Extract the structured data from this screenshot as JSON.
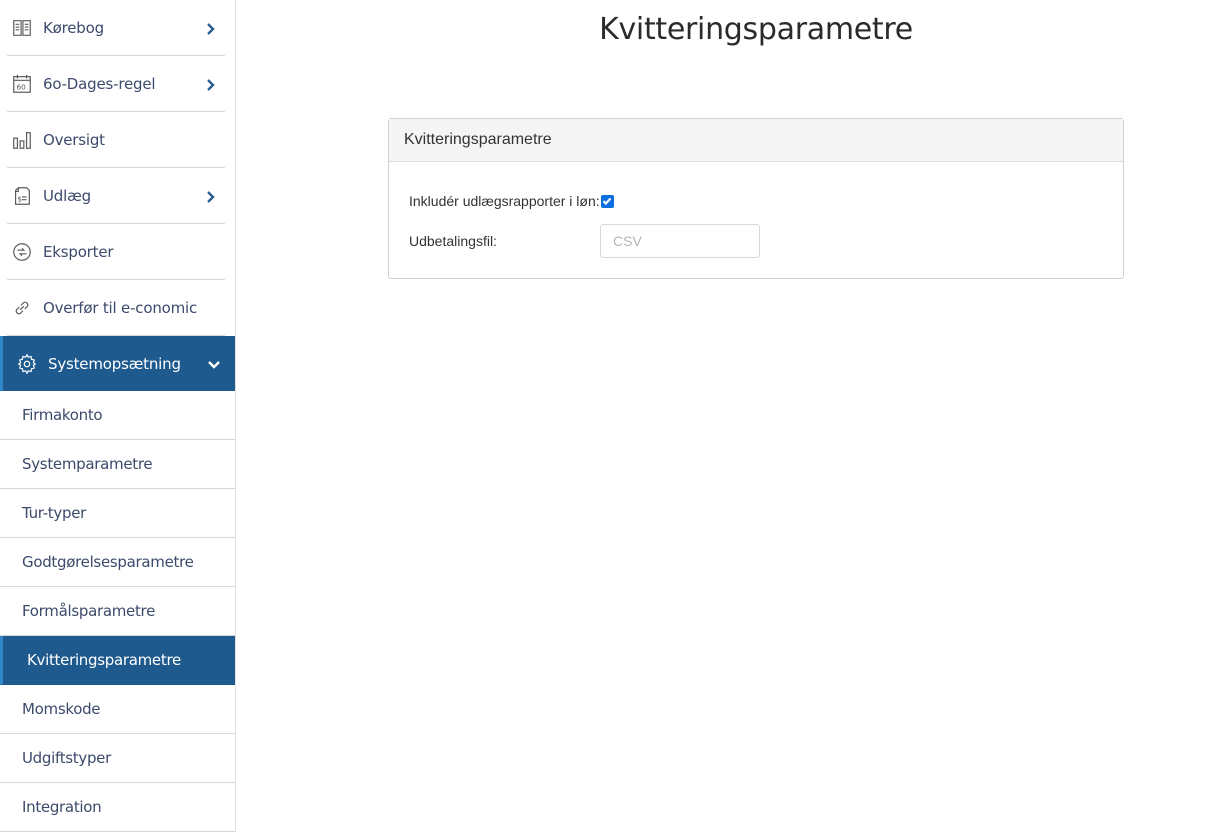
{
  "sidebar": {
    "nav": [
      {
        "label": "Kørebog",
        "icon": "book-icon",
        "has_chevron": true
      },
      {
        "label": "6o-Dages-regel",
        "icon": "calendar-60-icon",
        "has_chevron": true
      },
      {
        "label": "Oversigt",
        "icon": "bar-chart-icon",
        "has_chevron": false
      },
      {
        "label": "Udlæg",
        "icon": "receipt-icon",
        "has_chevron": true
      },
      {
        "label": "Eksporter",
        "icon": "export-icon",
        "has_chevron": false
      },
      {
        "label": "Overfør til e-conomic",
        "icon": "link-icon",
        "has_chevron": false
      },
      {
        "label": "Systemopsætning",
        "icon": "gear-icon",
        "has_chevron": true,
        "expanded": true
      }
    ],
    "sub_items": [
      {
        "label": "Firmakonto"
      },
      {
        "label": "Systemparametre"
      },
      {
        "label": "Tur-typer"
      },
      {
        "label": "Godtgørelsesparametre"
      },
      {
        "label": "Formålsparametre"
      },
      {
        "label": "Kvitteringsparametre",
        "active": true
      },
      {
        "label": "Momskode"
      },
      {
        "label": "Udgiftstyper"
      },
      {
        "label": "Integration"
      }
    ]
  },
  "main": {
    "title": "Kvitteringsparametre",
    "panel": {
      "heading": "Kvitteringsparametre",
      "include_label": "Inkludér udlægsrapporter i løn:",
      "include_checked": true,
      "payout_label": "Udbetalingsfil:",
      "payout_value": "",
      "payout_placeholder": "CSV"
    }
  },
  "colors": {
    "sidebar_active_bg": "#1e5a8e",
    "sidebar_active_border": "#2f86c9",
    "nav_text": "#3c4a6b",
    "checkbox": "#0b6fe0"
  }
}
